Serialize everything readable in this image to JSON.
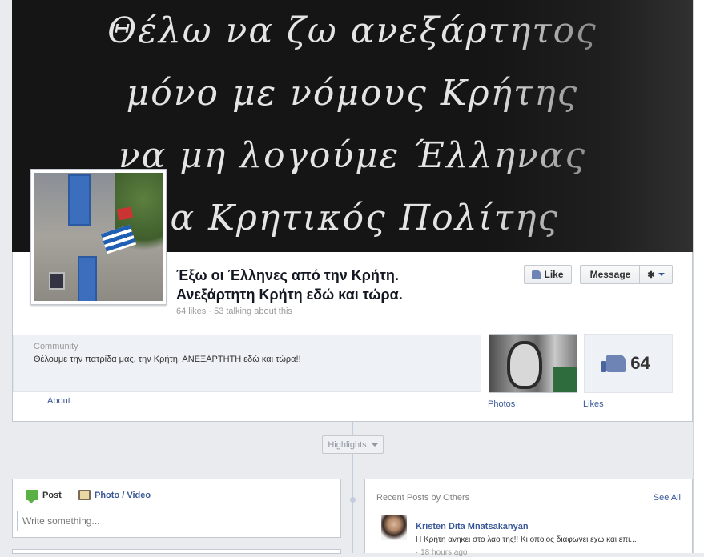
{
  "cover": {
    "lines": [
      "Θέλω να ζω ανεξάρτητος",
      "μόνο με νόμους Κρήτης",
      "να μη λογούμε Έλληνας",
      "μα Κρητικός Πολίτης"
    ]
  },
  "page": {
    "name_line1": "Έξω οι Έλληνες από την Κρήτη.",
    "name_line2": "Ανεξάρτητη Κρήτη εδώ και τώρα.",
    "stats": "64 likes · 53 talking about this"
  },
  "actions": {
    "like_label": "Like",
    "message_label": "Message",
    "gear_icon": "gear-icon"
  },
  "about": {
    "category": "Community",
    "description": "Θέλουμε την πατρίδα μας, την Κρήτη, ΑΝΕΞΑΡΤΗΤΗ εδώ και τώρα!!",
    "link_label": "About"
  },
  "apps": {
    "photos_label": "Photos",
    "likes_count": "64",
    "likes_label": "Likes"
  },
  "timeline": {
    "highlights_label": "Highlights"
  },
  "composer": {
    "tab_post": "Post",
    "tab_photo": "Photo / Video",
    "placeholder": "Write something..."
  },
  "recent_posts": {
    "title": "Recent Posts by Others",
    "see_all": "See All",
    "items": [
      {
        "author": "Kristen Dita Mnatsakanyan",
        "text": "Η Κρήτη ανηκει στο λαο της!! Κι οποιος διαφωνει εχω και επι...",
        "meta": "· 18 hours ago"
      }
    ]
  },
  "colors": {
    "link": "#3b5998",
    "background": "#e9ebee",
    "cover_bg": "#151515"
  }
}
